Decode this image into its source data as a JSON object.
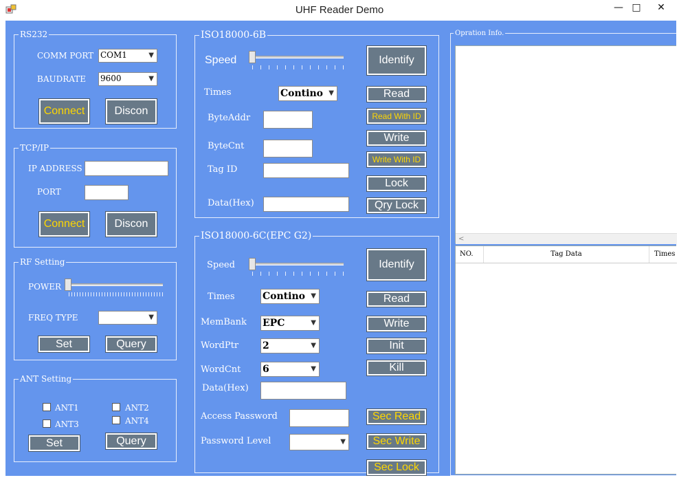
{
  "window": {
    "title": "UHF Reader Demo",
    "minimize": "—",
    "maximize": "□",
    "close": "✕"
  },
  "rs232": {
    "title": "RS232",
    "comm_port_label": "COMM PORT",
    "comm_port_value": "COM1",
    "baudrate_label": "BAUDRATE",
    "baudrate_value": "9600",
    "connect": "Connect",
    "disconnect": "Discon"
  },
  "tcpip": {
    "title": "TCP/IP",
    "ip_label": "IP ADDRESS",
    "ip_value": "",
    "port_label": "PORT",
    "port_value": "",
    "connect": "Connect",
    "disconnect": "Discon"
  },
  "rf": {
    "title": "RF Setting",
    "power_label": "POWER",
    "power_level": 0,
    "freq_label": "FREQ TYPE",
    "freq_value": "",
    "set": "Set",
    "query": "Query"
  },
  "ant": {
    "title": "ANT Setting",
    "ant1": "ANT1",
    "ant2": "ANT2",
    "ant3": "ANT3",
    "ant4": "ANT4",
    "set": "Set",
    "query": "Query"
  },
  "iso6b": {
    "title": "ISO18000-6B",
    "speed_label": "Speed",
    "speed_level": 0,
    "identify": "Identify",
    "times_label": "Times",
    "times_value": "Contino",
    "read": "Read",
    "read_with_id": "Read With ID",
    "byteaddr_label": "ByteAddr",
    "write": "Write",
    "bytecnt_label": "ByteCnt",
    "write_with_id": "Write With ID",
    "tagid_label": "Tag ID",
    "lock": "Lock",
    "data_label": "Data(Hex)",
    "qry_lock": "Qry Lock"
  },
  "iso6c": {
    "title": "ISO18000-6C(EPC G2)",
    "speed_label": "Speed",
    "speed_level": 0,
    "identify": "Identify",
    "times_label": "Times",
    "times_value": "Contino",
    "read": "Read",
    "membank_label": "MemBank",
    "membank_value": "EPC",
    "write": "Write",
    "wordptr_label": "WordPtr",
    "wordptr_value": "2",
    "init": "Init",
    "wordcnt_label": "WordCnt",
    "wordcnt_value": "6",
    "kill": "Kill",
    "data_label": "Data(Hex)",
    "access_pw_label": "Access Password",
    "sec_read": "Sec Read",
    "pw_level_label": "Password Level",
    "sec_write": "Sec Write",
    "sec_lock": "Sec Lock"
  },
  "opinfo": {
    "title": "Opration Info.",
    "col_no": "NO.",
    "col_tag": "Tag Data",
    "col_times": "Times"
  },
  "colors": {
    "client_bg": "#6495ed",
    "button_bg": "#687988",
    "accent_text": "#ffd700"
  }
}
